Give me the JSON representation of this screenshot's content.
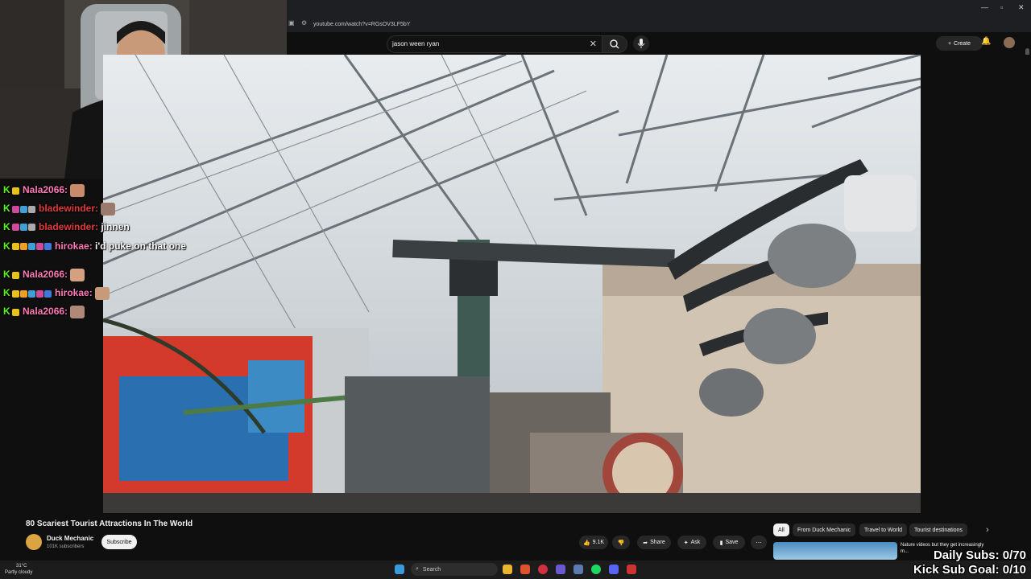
{
  "browser": {
    "url": "youtube.com/watch?v=RGsOV3LF5bY"
  },
  "youtube": {
    "search_value": "jason ween ryan",
    "create_label": "Create",
    "video_title": "80 Scariest Tourist Attractions In The World",
    "channel_name": "Duck Mechanic",
    "channel_subs": "101K subscribers",
    "subscribe_label": "Subscribe",
    "likes": "9.1K",
    "share_label": "Share",
    "ask_label": "Ask",
    "save_label": "Save",
    "chips": [
      "All",
      "From Duck Mechanic",
      "Travel to World",
      "Tourist destinations"
    ],
    "recommendation_title": "Nature videos but they get increasingly m..."
  },
  "chat": {
    "messages": [
      {
        "user": "Nala2066:",
        "text": "",
        "color": "#ff7ab6"
      },
      {
        "user": "bladewinder:",
        "text": "",
        "color": "#e03a3a"
      },
      {
        "user": "bladewinder:",
        "text": "jinnen",
        "color": "#e03a3a"
      },
      {
        "user": "hirokae:",
        "text": "i'd puke on that one",
        "color": "#ff7ab6"
      },
      {
        "user": "Nala2066:",
        "text": "",
        "color": "#ff7ab6"
      },
      {
        "user": "hirokae:",
        "text": "",
        "color": "#ff7ab6"
      },
      {
        "user": "Nala2066:",
        "text": "",
        "color": "#ff7ab6"
      }
    ]
  },
  "overlay": {
    "daily_subs": "Daily Subs: 0/70",
    "kick_sub_goal": "Kick Sub Goal: 0/10"
  },
  "taskbar": {
    "temperature": "31°C",
    "weather": "Partly cloudy",
    "search_label": "Search"
  },
  "colors": {
    "kick_green": "#53fc18",
    "background": "#0f0f0f"
  }
}
